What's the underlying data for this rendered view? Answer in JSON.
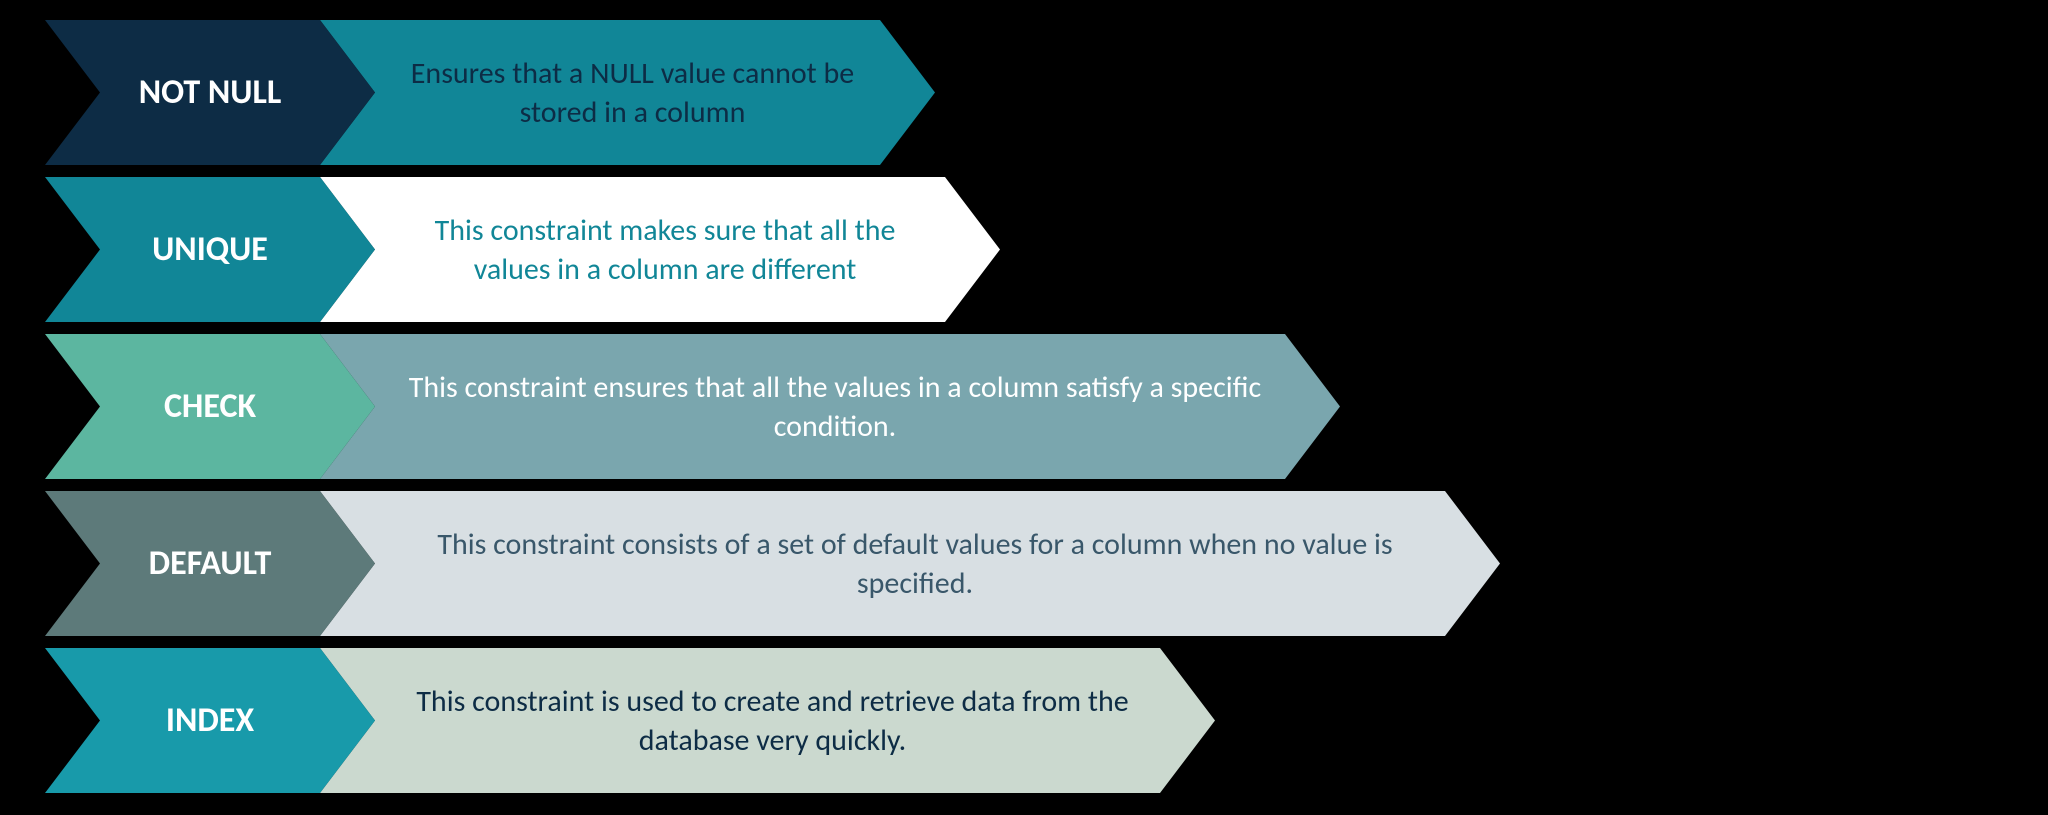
{
  "rows": [
    {
      "label": "NOT NULL",
      "desc": "Ensures that a NULL value cannot be stored in a column",
      "labelColor": "#0d2c45",
      "descColor": "#118697",
      "descTextColor": "#0d2c45",
      "descWidth": 615
    },
    {
      "label": "UNIQUE",
      "desc": "This constraint makes sure that all the values in a column are different",
      "labelColor": "#118697",
      "descColor": "#ffffff",
      "descTextColor": "#118697",
      "descWidth": 680
    },
    {
      "label": "CHECK",
      "desc": "This constraint ensures that all the values in a column satisfy a specific condition.",
      "labelColor": "#5cb6a0",
      "descColor": "#7aa6ae",
      "descTextColor": "#ffffff",
      "descWidth": 1020
    },
    {
      "label": "DEFAULT",
      "desc": "This constraint consists of a set of default values for a column when no value is specified.",
      "labelColor": "#5d7a7a",
      "descColor": "#d8dfe3",
      "descTextColor": "#39576a",
      "descWidth": 1180
    },
    {
      "label": "INDEX",
      "desc": "This constraint is used to create and retrieve data from the database very quickly.",
      "labelColor": "#189aaa",
      "descColor": "#cbd9cf",
      "descTextColor": "#0d2c45",
      "descWidth": 895
    }
  ]
}
